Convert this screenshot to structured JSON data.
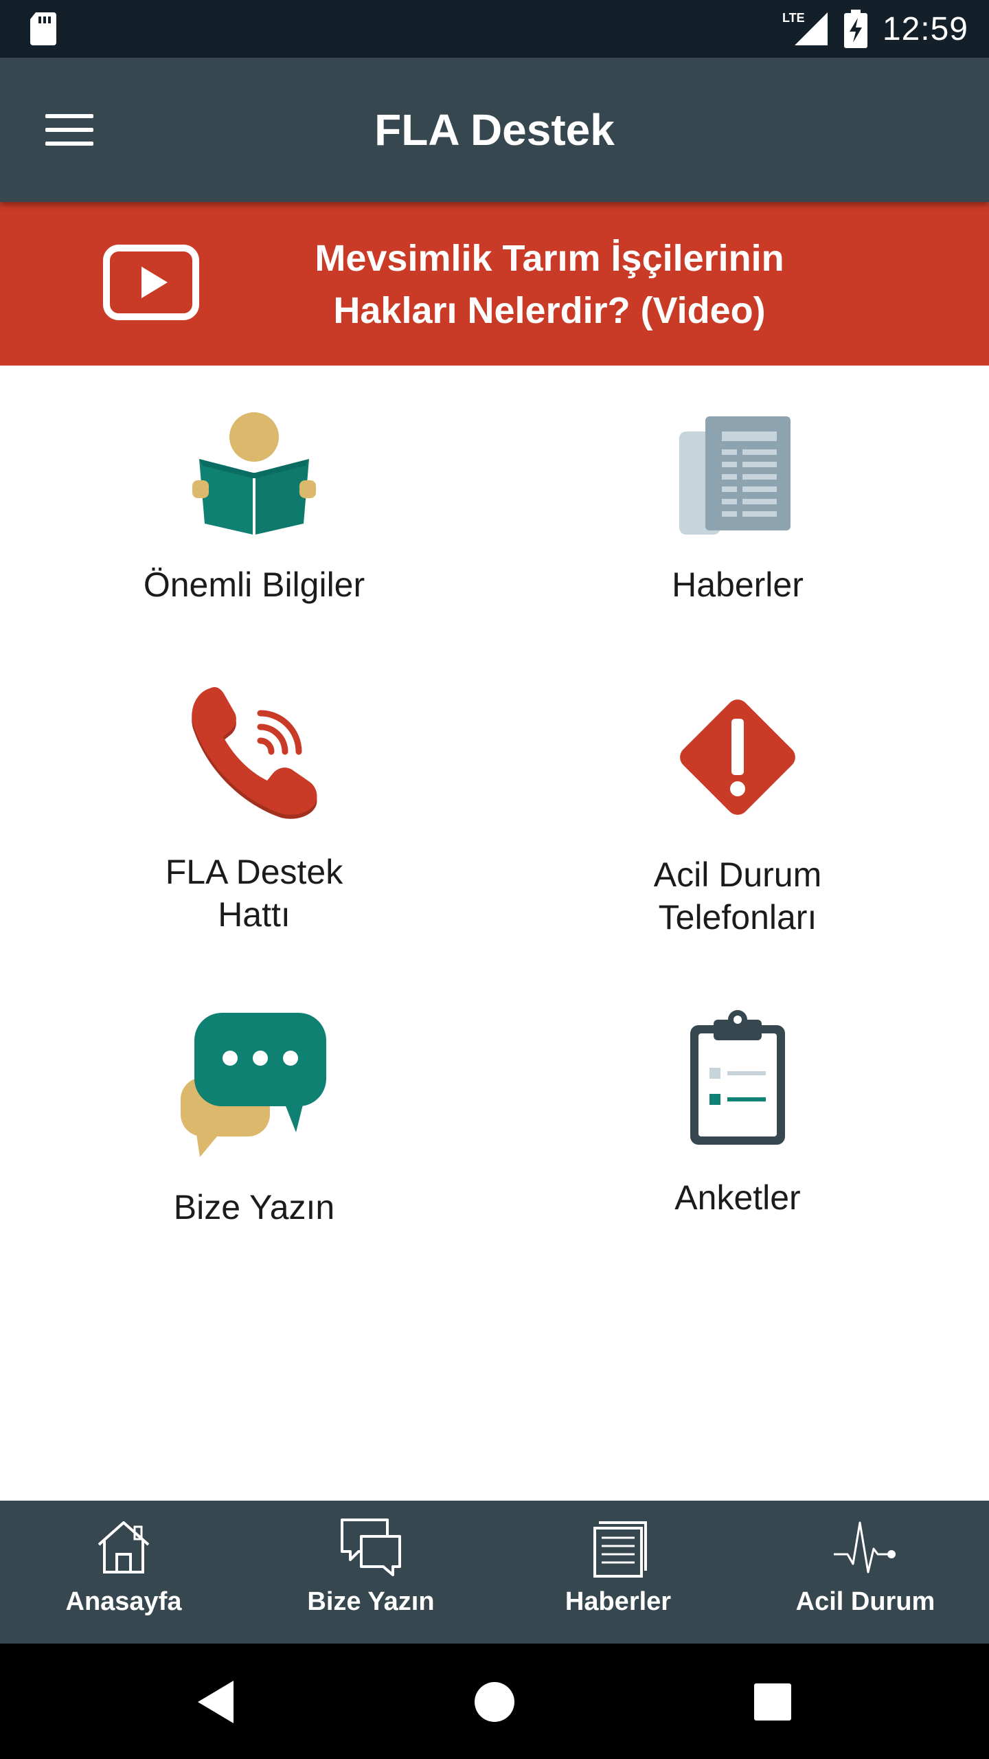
{
  "status_bar": {
    "time": "12:59",
    "network": "LTE",
    "icons": [
      "sd-card-icon",
      "lte-signal-icon",
      "battery-charging-icon"
    ]
  },
  "app_bar": {
    "title": "FLA Destek",
    "menu_icon": "hamburger-menu-icon"
  },
  "banner": {
    "line1": "Mevsimlik Tarım İşçilerinin",
    "line2": "Hakları Nelerdir? (Video)",
    "icon": "play-video-icon",
    "color": "#c93a27"
  },
  "grid": [
    {
      "label": "Önemli Bilgiler",
      "icon": "reading-person-icon"
    },
    {
      "label": "Haberler",
      "icon": "newspaper-icon"
    },
    {
      "label": "FLA Destek\nHattı",
      "icon": "phone-call-icon"
    },
    {
      "label": "Acil Durum\nTelefonları",
      "icon": "warning-diamond-icon"
    },
    {
      "label": "Bize Yazın",
      "icon": "chat-bubbles-icon"
    },
    {
      "label": "Anketler",
      "icon": "clipboard-icon"
    }
  ],
  "bottom_nav": [
    {
      "label": "Anasayfa",
      "icon": "home-icon"
    },
    {
      "label": "Bize Yazın",
      "icon": "chat-icon"
    },
    {
      "label": "Haberler",
      "icon": "news-icon"
    },
    {
      "label": "Acil Durum",
      "icon": "heartbeat-icon"
    }
  ],
  "colors": {
    "app_bar": "#37474f",
    "status_bar": "#13202a",
    "accent_red": "#c93a27",
    "teal": "#0e8173",
    "gold": "#dbb86c"
  }
}
